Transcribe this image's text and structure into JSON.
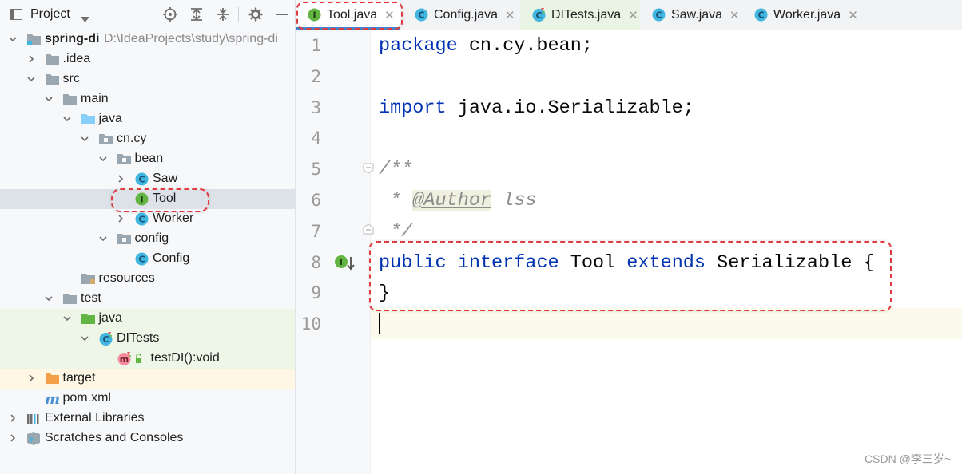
{
  "project_panel": {
    "title": "Project",
    "toolbar_icons": [
      "locate-icon",
      "expand-all-icon",
      "collapse-all-icon",
      "gear-icon",
      "minimize-icon"
    ]
  },
  "tree": [
    {
      "label": "spring-di",
      "path": "D:\\IdeaProjects\\study\\spring-di",
      "icon": "module-folder-icon",
      "depth": 0,
      "expanded": true
    },
    {
      "label": ".idea",
      "icon": "folder-icon",
      "depth": 1,
      "expanded": false
    },
    {
      "label": "src",
      "icon": "folder-icon",
      "depth": 1,
      "expanded": true
    },
    {
      "label": "main",
      "icon": "folder-icon",
      "depth": 2,
      "expanded": true
    },
    {
      "label": "java",
      "icon": "source-folder-icon",
      "depth": 3,
      "expanded": true
    },
    {
      "label": "cn.cy",
      "icon": "package-icon",
      "depth": 4,
      "expanded": true
    },
    {
      "label": "bean",
      "icon": "package-icon",
      "depth": 5,
      "expanded": true
    },
    {
      "label": "Saw",
      "icon": "class-icon",
      "depth": 6,
      "expanded": false
    },
    {
      "label": "Tool",
      "icon": "interface-icon",
      "depth": 6,
      "expanded": null
    },
    {
      "label": "Worker",
      "icon": "class-icon",
      "depth": 6,
      "expanded": false
    },
    {
      "label": "config",
      "icon": "package-icon",
      "depth": 5,
      "expanded": true
    },
    {
      "label": "Config",
      "icon": "class-icon",
      "depth": 6,
      "expanded": null
    },
    {
      "label": "resources",
      "icon": "resources-folder-icon",
      "depth": 3,
      "expanded": null
    },
    {
      "label": "test",
      "icon": "folder-icon",
      "depth": 2,
      "expanded": true
    },
    {
      "label": "java",
      "icon": "test-folder-icon",
      "depth": 3,
      "expanded": true
    },
    {
      "label": "DITests",
      "icon": "test-class-icon",
      "depth": 4,
      "expanded": true
    },
    {
      "label": "testDI():void",
      "icon": "method-icon",
      "depth": 5,
      "expanded": null
    },
    {
      "label": "target",
      "icon": "excluded-folder-icon",
      "depth": 1,
      "expanded": false
    },
    {
      "label": "pom.xml",
      "icon": "maven-icon",
      "depth": 1,
      "expanded": null
    },
    {
      "label": "External Libraries",
      "icon": "libraries-icon",
      "depth": 0,
      "expanded": false
    },
    {
      "label": "Scratches and Consoles",
      "icon": "scratches-icon",
      "depth": 0,
      "expanded": false
    }
  ],
  "tabs": [
    {
      "label": "Tool.java",
      "icon": "interface-icon",
      "active": true
    },
    {
      "label": "Config.java",
      "icon": "class-icon",
      "active": false
    },
    {
      "label": "DITests.java",
      "icon": "test-class-icon",
      "active": false
    },
    {
      "label": "Saw.java",
      "icon": "class-icon",
      "active": false
    },
    {
      "label": "Worker.java",
      "icon": "class-icon",
      "active": false
    }
  ],
  "editor": {
    "line_numbers": [
      "1",
      "2",
      "3",
      "4",
      "5",
      "6",
      "7",
      "8",
      "9",
      "10"
    ],
    "lines": [
      [
        {
          "t": "package",
          "c": "kw"
        },
        {
          "t": " cn.cy.bean;",
          "c": ""
        }
      ],
      [],
      [
        {
          "t": "import",
          "c": "kw"
        },
        {
          "t": " java.io.Serializable;",
          "c": ""
        }
      ],
      [],
      [
        {
          "t": "/**",
          "c": "cmt"
        }
      ],
      [
        {
          "t": " * ",
          "c": "cmt"
        },
        {
          "t": "@Author",
          "c": "ann"
        },
        {
          "t": " lss",
          "c": "cmt"
        }
      ],
      [
        {
          "t": " */",
          "c": "cmt"
        }
      ],
      [
        {
          "t": "public",
          "c": "kw"
        },
        {
          "t": " ",
          "c": ""
        },
        {
          "t": "interface",
          "c": "kw"
        },
        {
          "t": " Tool ",
          "c": ""
        },
        {
          "t": "extends",
          "c": "kw"
        },
        {
          "t": " Serializable {",
          "c": ""
        }
      ],
      [
        {
          "t": "}",
          "c": ""
        }
      ],
      []
    ]
  },
  "watermark": "CSDN @李三岁~",
  "colors": {
    "highlight_box": "#e0393e",
    "keyword": "#0033b3",
    "comment": "#8c8c8c"
  }
}
